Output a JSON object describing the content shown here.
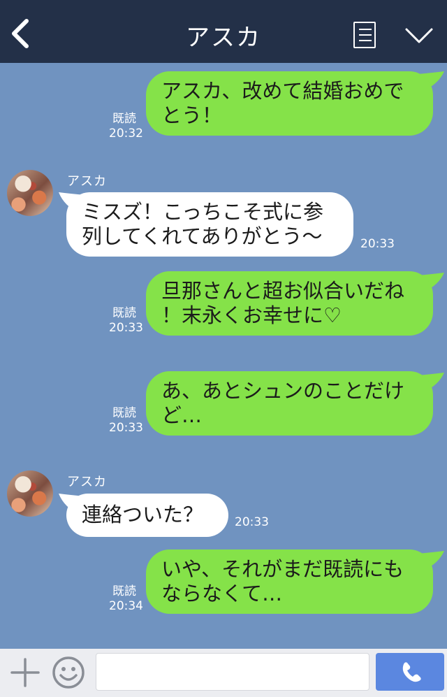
{
  "header": {
    "title": "アスカ"
  },
  "contact": {
    "name": "アスカ"
  },
  "messages": [
    {
      "dir": "out",
      "lines": [
        "アスカ、改めて結婚おめで",
        "とう！"
      ],
      "read": "既読",
      "time": "20:32"
    },
    {
      "dir": "in",
      "lines": [
        "ミスズ！こっちこそ式に参",
        "列してくれてありがとう〜"
      ],
      "time": "20:33"
    },
    {
      "dir": "out",
      "lines": [
        "旦那さんと超お似合いだね",
        "！末永くお幸せに♡"
      ],
      "read": "既読",
      "time": "20:33"
    },
    {
      "dir": "out",
      "lines": [
        "あ、あとシュンのことだけ",
        "ど…"
      ],
      "read": "既読",
      "time": "20:33"
    },
    {
      "dir": "in",
      "lines": [
        "連絡ついた？"
      ],
      "time": "20:33"
    },
    {
      "dir": "out",
      "lines": [
        "いや、それがまだ既読にも",
        "ならなくて…"
      ],
      "read": "既読",
      "time": "20:34"
    }
  ],
  "colors": {
    "header": "#233048",
    "chat_bg": "#7093c0",
    "out_bubble": "#85e249",
    "in_bubble": "#ffffff",
    "send_button": "#5b87e0"
  },
  "icons": {
    "back": "chevron-left-icon",
    "menu": "list-icon",
    "collapse": "chevron-down-icon",
    "add": "plus-icon",
    "sticker": "smiley-icon",
    "call": "phone-icon"
  }
}
